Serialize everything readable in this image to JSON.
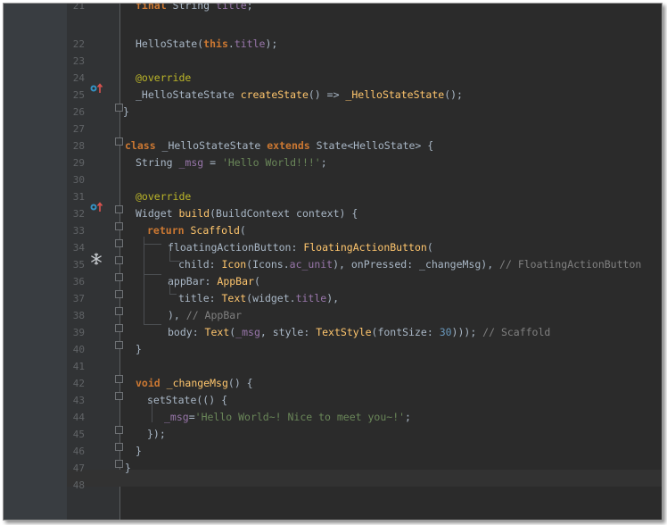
{
  "editor": {
    "lines": [
      {
        "n": "21",
        "html": "<span class='kw'>final</span> String <span class='fld'>title</span>;"
      },
      {
        "n": "22",
        "html": "HelloState(<span class='kw'>this</span>.<span class='fld'>title</span>);"
      },
      {
        "n": "23",
        "html": ""
      },
      {
        "n": "24",
        "html": "<span class='ann'>@override</span>"
      },
      {
        "n": "25",
        "html": "_HelloStateState <span class='fn'>createState</span>() =&gt; <span class='fn'>_HelloStateState</span>();"
      },
      {
        "n": "26",
        "html": "}"
      },
      {
        "n": "27",
        "html": ""
      },
      {
        "n": "28",
        "html": "<span class='kw'>class</span> _HelloStateState <span class='kw'>extends</span> State&lt;HelloState&gt; {"
      },
      {
        "n": "29",
        "html": "String <span class='fld'>_msg</span> = <span class='str'>'Hello World!!!'</span>;"
      },
      {
        "n": "30",
        "html": ""
      },
      {
        "n": "31",
        "html": "<span class='ann'>@override</span>"
      },
      {
        "n": "32",
        "html": "Widget <span class='fn'>build</span>(BuildContext context) {"
      },
      {
        "n": "33",
        "html": "<span class='kw'>return</span> <span class='fn'>Scaffold</span>("
      },
      {
        "n": "34",
        "html": "floatingActionButton: <span class='fn'>FloatingActionButton</span>("
      },
      {
        "n": "35",
        "html": "child: <span class='fn'>Icon</span>(Icons.<span class='fld'>ac_unit</span>), onPressed: _changeMsg), <span class='cmt'>// FloatingActionButton</span>"
      },
      {
        "n": "36",
        "html": "appBar: <span class='fn'>AppBar</span>("
      },
      {
        "n": "37",
        "html": "title: <span class='fn'>Text</span>(widget.<span class='fld'>title</span>),"
      },
      {
        "n": "38",
        "html": "), <span class='cmt'>// AppBar</span>"
      },
      {
        "n": "39",
        "html": "body: <span class='fn'>Text</span>(<span class='fld'>_msg</span>, style: <span class='fn'>TextStyle</span>(fontSize: <span class='num'>30</span>))); <span class='cmt'>// Scaffold</span>"
      },
      {
        "n": "40",
        "html": "}"
      },
      {
        "n": "41",
        "html": ""
      },
      {
        "n": "42",
        "html": "<span class='kw'>void</span> <span class='fn'>_changeMsg</span>() {"
      },
      {
        "n": "43",
        "html": "setState(() {"
      },
      {
        "n": "44",
        "html": "<span class='fld'>_msg</span>=<span class='str'>'Hello World~! Nice to meet you~!'</span>;"
      },
      {
        "n": "45",
        "html": "});"
      },
      {
        "n": "46",
        "html": "}"
      },
      {
        "n": "47",
        "html": "}"
      },
      {
        "n": "48",
        "html": ""
      }
    ]
  },
  "icons": {
    "override_marker": "override-up-arrow-icon",
    "ac_unit": "snowflake-icon",
    "fold": "fold-marker-icon"
  },
  "colors": {
    "background": "#2b2b2b",
    "gutter": "#313335",
    "keyword": "#cc7832",
    "function": "#ffc66d",
    "string": "#6a8759",
    "field": "#9876aa",
    "annotation": "#bbb529",
    "comment": "#808080"
  }
}
